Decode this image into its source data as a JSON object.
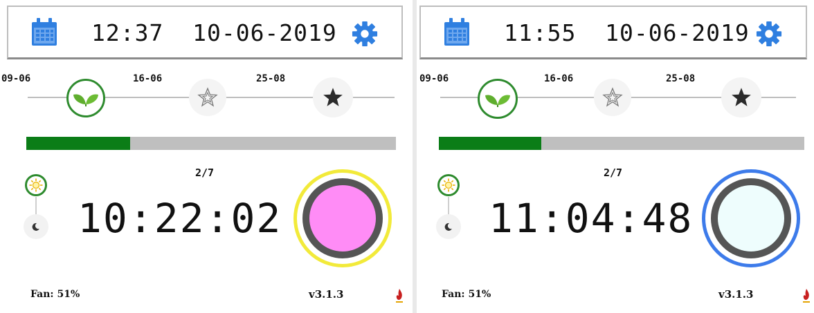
{
  "panels": [
    {
      "header": {
        "time": "12:37",
        "date": "10-06-2019"
      },
      "timeline": {
        "stages": [
          {
            "date": "09-06",
            "icon": "seedling-icon",
            "state": "current"
          },
          {
            "date": "16-06",
            "icon": "flower-outline-icon",
            "state": "upcoming"
          },
          {
            "date": "25-08",
            "icon": "star-icon",
            "state": "upcoming"
          }
        ]
      },
      "progress": {
        "fraction": 0.28
      },
      "day_count": "2/7",
      "light_mode": {
        "active": "sun-icon",
        "inactive": "moon-icon"
      },
      "countdown": "10:22:02",
      "light_status": {
        "ring_color": "#f2ea3a",
        "fill_color": "#ff8cf6"
      },
      "footer": {
        "fan": "Fan: 51%",
        "version": "v3.1.3"
      }
    },
    {
      "header": {
        "time": "11:55",
        "date": "10-06-2019"
      },
      "timeline": {
        "stages": [
          {
            "date": "09-06",
            "icon": "seedling-icon",
            "state": "current"
          },
          {
            "date": "16-06",
            "icon": "flower-outline-icon",
            "state": "upcoming"
          },
          {
            "date": "25-08",
            "icon": "star-icon",
            "state": "upcoming"
          }
        ]
      },
      "progress": {
        "fraction": 0.28
      },
      "day_count": "2/7",
      "light_mode": {
        "active": "sun-icon",
        "inactive": "moon-icon"
      },
      "countdown": "11:04:48",
      "light_status": {
        "ring_color": "#3d7bea",
        "fill_color": "#eefdfd"
      },
      "footer": {
        "fan": "Fan: 51%",
        "version": "v3.1.3"
      }
    }
  ],
  "colors": {
    "accent_blue": "#2f7fe0",
    "stage_green": "#2e8b2e",
    "progress_green": "#0b7d17"
  }
}
